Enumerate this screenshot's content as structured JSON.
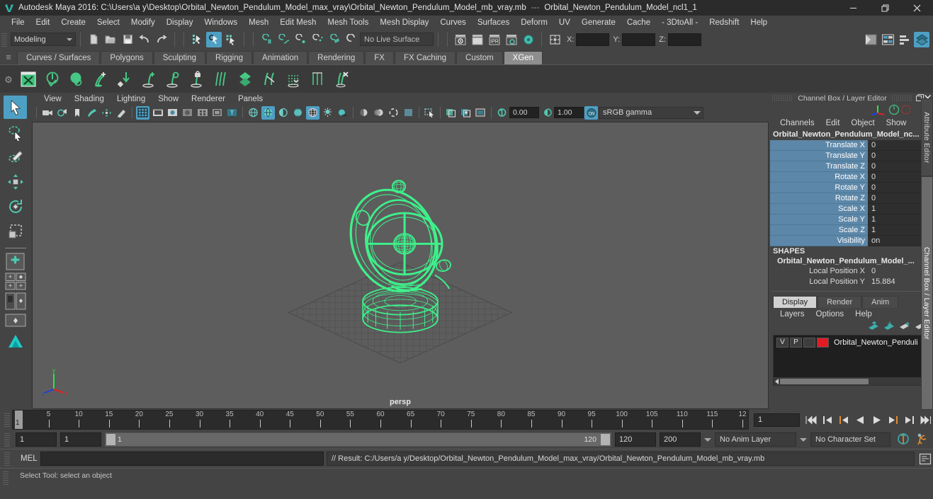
{
  "window": {
    "app_title": "Autodesk Maya 2016: C:\\Users\\a y\\Desktop\\Orbital_Newton_Pendulum_Model_max_vray\\Orbital_Newton_Pendulum_Model_mb_vray.mb",
    "title_separator": "---",
    "active_object_title": "Orbital_Newton_Pendulum_Model_ncl1_1",
    "minimize": "─",
    "restore": "❐",
    "close": "✕"
  },
  "menubar": {
    "items": [
      "File",
      "Edit",
      "Create",
      "Select",
      "Modify",
      "Display",
      "Windows",
      "Mesh",
      "Edit Mesh",
      "Mesh Tools",
      "Mesh Display",
      "Curves",
      "Surfaces",
      "Deform",
      "UV",
      "Generate",
      "Cache",
      "- 3DtoAll -",
      "Redshift",
      "Help"
    ]
  },
  "statusline": {
    "menu_set": "Modeling",
    "live_surface": "No Live Surface",
    "coord_labels": {
      "x": "X:",
      "y": "Y:",
      "z": "Z:"
    },
    "coord_values": {
      "x": "",
      "y": "",
      "z": ""
    },
    "icons": [
      "new-scene-icon",
      "open-scene-icon",
      "save-scene-icon",
      "undo-icon",
      "redo-icon",
      "select-by-hierarchy-icon",
      "select-by-object-icon",
      "select-by-component-icon",
      "snap-to-grid-icon",
      "snap-to-curve-icon",
      "snap-to-point-icon",
      "snap-to-projected-center-icon",
      "snap-to-view-plane-icon",
      "make-live-icon",
      "render-view-icon",
      "render-current-frame-icon",
      "ipr-render-icon",
      "render-settings-icon",
      "hypershade-icon",
      "toggle-selection-mask-icon",
      "show-hide-editors-icon",
      "attribute-editor-toggle-icon",
      "tool-settings-toggle-icon",
      "channel-box-toggle-icon"
    ]
  },
  "shelf": {
    "tabs": [
      "Curves / Surfaces",
      "Polygons",
      "Sculpting",
      "Rigging",
      "Animation",
      "Rendering",
      "FX",
      "FX Caching",
      "Custom",
      "XGen"
    ],
    "active_tab": "XGen",
    "icons": [
      "xgen-editor-icon",
      "xgen-create-description-icon",
      "xgen-preview-icon",
      "xgen-add-groom-icon",
      "xgen-place-icon",
      "xgen-add-guide-icon",
      "xgen-select-guide-icon",
      "xgen-lock-guide-icon",
      "xgen-comb-icon",
      "xgen-density-icon",
      "xgen-cut-icon",
      "xgen-noise-icon",
      "xgen-clump-icon",
      "xgen-delete-icon"
    ]
  },
  "toolbox": {
    "items": [
      {
        "name": "select-tool",
        "active": true
      },
      {
        "name": "lasso-select-tool",
        "active": false
      },
      {
        "name": "paint-selection-tool",
        "active": false
      },
      {
        "name": "move-tool",
        "active": false
      },
      {
        "name": "rotate-tool",
        "active": false
      },
      {
        "name": "scale-tool",
        "active": false
      }
    ],
    "layout_items": [
      "single-perspective-layout",
      "four-view-layout",
      "two-pane-layout",
      "outliner-persp-layout",
      "hypergraph-layout"
    ]
  },
  "viewport": {
    "panel_menus": [
      "View",
      "Shading",
      "Lighting",
      "Show",
      "Renderer",
      "Panels"
    ],
    "camera_label": "persp",
    "exposure_value": "0.00",
    "gamma_value": "1.00",
    "color_management": "sRGB gamma",
    "axis_labels": {
      "x": "x",
      "y": "y",
      "z": "z"
    },
    "toolbar_icons": [
      "select-camera-icon",
      "camera-attributes-icon",
      "bookmark-icon",
      "image-plane-icon",
      "two-d-pan-zoom-icon",
      "grease-pencil-icon",
      "grid-toggle-icon",
      "film-gate-icon",
      "resolution-gate-icon",
      "gate-mask-icon",
      "film-origin-icon",
      "safe-action-icon",
      "safe-title-icon",
      "wireframe-shading-icon",
      "smooth-shade-all-icon",
      "smooth-shade-selected-icon",
      "flat-shade-icon",
      "wireframe-on-shaded-icon",
      "lighting-toggle-icon",
      "shadows-toggle-icon",
      "screen-space-ao-icon",
      "motion-blur-icon",
      "multisample-icon",
      "depth-of-field-icon",
      "isolate-select-icon",
      "xray-toggle-icon",
      "xray-joints-icon",
      "xray-active-components-icon",
      "exposure-icon",
      "gamma-icon",
      "color-management-toggle-icon"
    ]
  },
  "channel_box": {
    "panel_title": "Channel Box / Layer Editor",
    "undock_icon": "undock-icon",
    "close_icon": "close-icon",
    "menus": [
      "Channels",
      "Edit",
      "Object",
      "Show"
    ],
    "object_name": "Orbital_Newton_Pendulum_Model_nc...",
    "transform_rows": [
      {
        "attr": "Translate X",
        "value": "0"
      },
      {
        "attr": "Translate Y",
        "value": "0"
      },
      {
        "attr": "Translate Z",
        "value": "0"
      },
      {
        "attr": "Rotate X",
        "value": "0"
      },
      {
        "attr": "Rotate Y",
        "value": "0"
      },
      {
        "attr": "Rotate Z",
        "value": "0"
      },
      {
        "attr": "Scale X",
        "value": "1"
      },
      {
        "attr": "Scale Y",
        "value": "1"
      },
      {
        "attr": "Scale Z",
        "value": "1"
      },
      {
        "attr": "Visibility",
        "value": "on"
      }
    ],
    "shapes_header": "SHAPES",
    "shape_name": "Orbital_Newton_Pendulum_Model_...",
    "shape_rows": [
      {
        "attr": "Local Position X",
        "value": "0"
      },
      {
        "attr": "Local Position Y",
        "value": "15.884"
      }
    ]
  },
  "layer_editor": {
    "tabs": [
      "Display",
      "Render",
      "Anim"
    ],
    "active_tab": "Display",
    "menus": [
      "Layers",
      "Options",
      "Help"
    ],
    "toolbar_icons": [
      "move-layer-up-icon",
      "move-layer-down-icon",
      "new-layer-icon",
      "new-layer-from-selected-icon"
    ],
    "layers": [
      {
        "visibility": "V",
        "playback": "P",
        "state": "",
        "color": "#e01b24",
        "name": "Orbital_Newton_Penduli"
      }
    ]
  },
  "dock_tabs": {
    "items": [
      "Attribute Editor",
      "Channel Box / Layer Editor"
    ],
    "active": "Channel Box / Layer Editor"
  },
  "timeline": {
    "tick_labels": [
      "5",
      "10",
      "15",
      "20",
      "25",
      "30",
      "35",
      "40",
      "45",
      "50",
      "55",
      "60",
      "65",
      "70",
      "75",
      "80",
      "85",
      "90",
      "95",
      "100",
      "105",
      "110",
      "115",
      "12"
    ],
    "current_frame": "1",
    "playback_field": "1",
    "controls": [
      "go-to-start-icon",
      "step-back-keyframe-icon",
      "step-back-frame-icon",
      "play-backwards-icon",
      "play-forwards-icon",
      "step-forward-frame-icon",
      "step-forward-keyframe-icon",
      "go-to-end-icon"
    ]
  },
  "range_bar": {
    "anim_start": "1",
    "range_start": "1",
    "slider_start_label": "1",
    "slider_end_label": "120",
    "range_end": "120",
    "anim_end": "200",
    "anim_layer": "No Anim Layer",
    "character_set": "No Character Set",
    "auto_key_icon": "auto-keyframe-icon",
    "anim_prefs_icon": "animation-preferences-icon"
  },
  "command_line": {
    "language_label": "MEL",
    "input_value": "",
    "result_text": "// Result: C:/Users/a y/Desktop/Orbital_Newton_Pendulum_Model_max_vray/Orbital_Newton_Pendulum_Model_mb_vray.mb",
    "script_editor_icon": "script-editor-icon"
  },
  "help_line": {
    "text": "Select Tool: select an object"
  },
  "colors": {
    "accent_blue": "#4e9fc4",
    "channel_attr_blue": "#5d87a8",
    "wireframe_green": "#3ef08a",
    "layer_red": "#e01b24",
    "bg_panel": "#444444",
    "bg_viewport": "#5d5d5d"
  }
}
